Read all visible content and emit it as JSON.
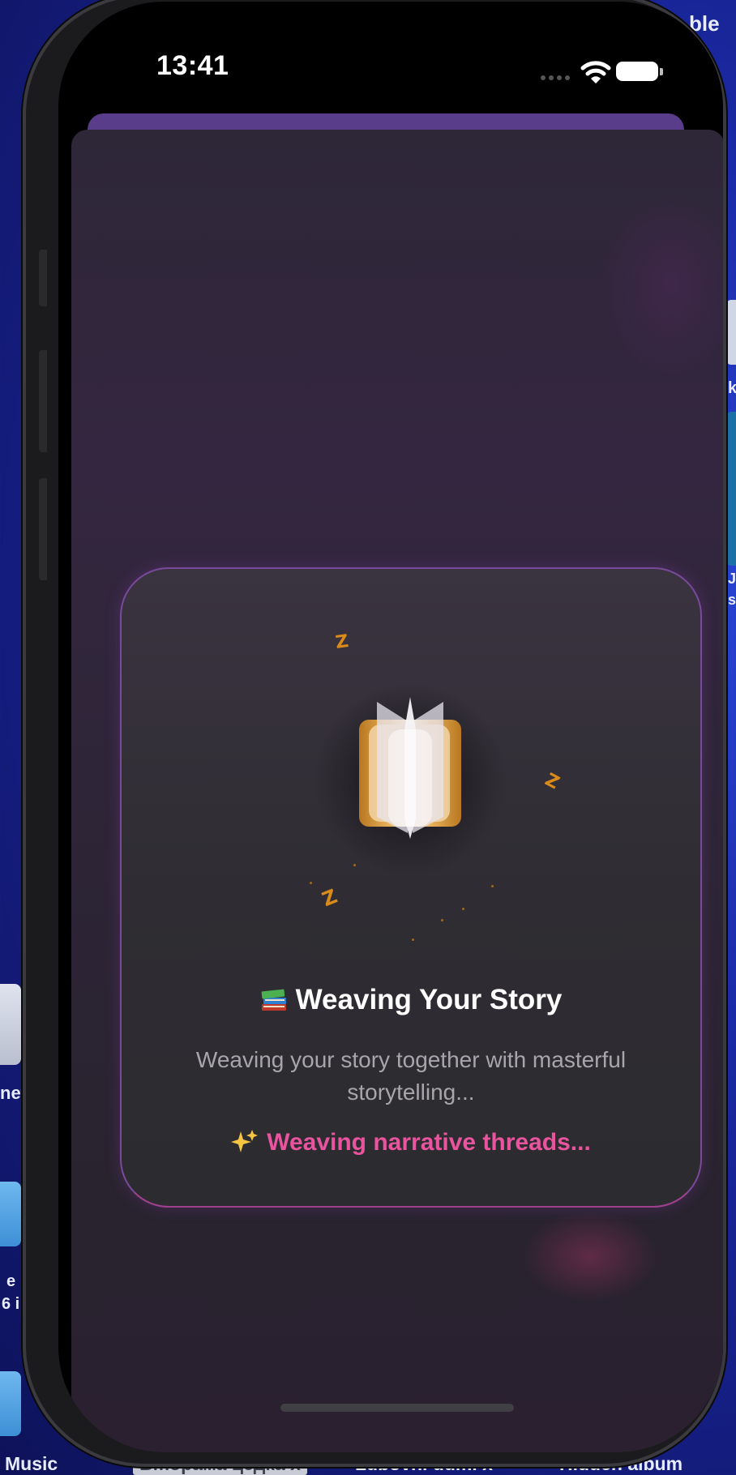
{
  "desktop": {
    "top_right_fragment": "ble",
    "left_fragments": [
      "net",
      "e",
      "6 i"
    ],
    "right_fragments": [
      "k",
      "J",
      "s"
    ],
    "bottom_labels": [
      "Music",
      "Вmopaма цедка х",
      "Lubovni dumi x",
      "Hidden album"
    ]
  },
  "status_bar": {
    "time": "13:41",
    "wifi_icon": "wifi-icon",
    "battery_icon": "battery-icon"
  },
  "loading_card": {
    "title_icon": "📚",
    "title": "Weaving Your Story",
    "subtitle": "Weaving your story together with masterful storytelling...",
    "status_icon": "✨",
    "status": "Weaving narrative threads...",
    "sleep_marks": [
      "Z",
      "Z",
      "Z"
    ]
  },
  "colors": {
    "accent": "#e8549d",
    "book_glow": "#d98a1a",
    "card_border": "#7a4a9a"
  }
}
